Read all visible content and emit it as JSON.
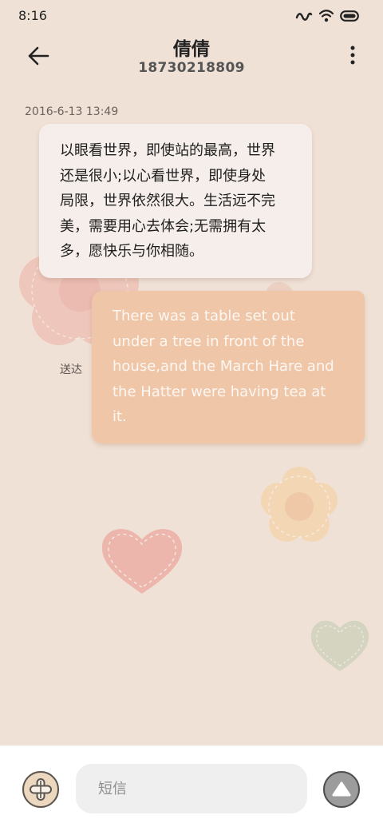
{
  "status_bar": {
    "time": "8:16",
    "icons": [
      "signal-icon",
      "wifi-icon",
      "battery-icon"
    ]
  },
  "header": {
    "contact_name": "倩倩",
    "contact_number": "18730218809",
    "back_icon": "back-arrow-icon",
    "more_icon": "more-vertical-icon"
  },
  "conversation": {
    "timestamp": "2016-6-13 13:49",
    "messages": [
      {
        "direction": "incoming",
        "lines": [
          "以眼看世界，即使站的最高，世界",
          "还是很小;以心看世界，即使身处",
          "局限，世界依然很大。生活远不完",
          "美，需要用心去体会;无需拥有太",
          "多，愿快乐与你相随。"
        ]
      },
      {
        "direction": "outgoing",
        "lines": [
          "There was a table set out",
          "under a tree in front of the",
          "house,and the March Hare and",
          "the Hatter were having tea at",
          "it."
        ],
        "status": "送达"
      }
    ]
  },
  "composer": {
    "placeholder": "短信",
    "value": "",
    "attach_icon": "attach-plus-icon",
    "send_icon": "send-icon"
  },
  "colors": {
    "background": "#f0e1d6",
    "incoming_bubble": "#f6eeea",
    "outgoing_bubble": "#efc7a8",
    "outgoing_text": "#fcf7f2"
  }
}
